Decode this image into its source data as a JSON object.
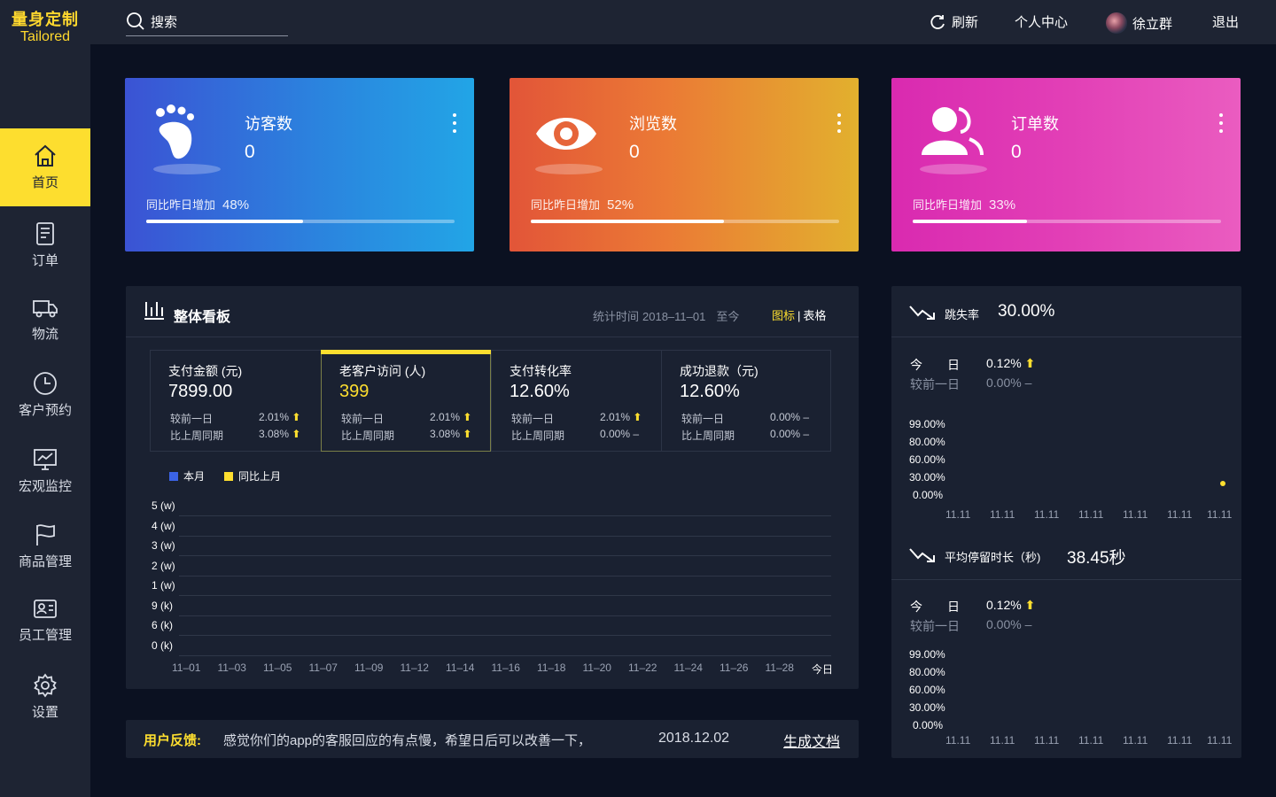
{
  "logo": {
    "cn": "量身定制",
    "en": "Tailored"
  },
  "sidebar": {
    "items": [
      {
        "label": "首页",
        "icon": "home-icon"
      },
      {
        "label": "订单",
        "icon": "order-icon"
      },
      {
        "label": "物流",
        "icon": "truck-icon"
      },
      {
        "label": "客户预约",
        "icon": "clock-icon"
      },
      {
        "label": "宏观监控",
        "icon": "monitor-icon"
      },
      {
        "label": "商品管理",
        "icon": "flag-icon"
      },
      {
        "label": "员工管理",
        "icon": "id-card-icon"
      },
      {
        "label": "设置",
        "icon": "gear-icon"
      }
    ],
    "active_index": 0
  },
  "topbar": {
    "search_label": "搜索",
    "refresh": "刷新",
    "profile": "个人中心",
    "user": "徐立群",
    "logout": "退出"
  },
  "cards": [
    {
      "title": "访客数",
      "value": "0",
      "sub": "同比昨日增加",
      "pct": "48%",
      "progress": 0.51
    },
    {
      "title": "浏览数",
      "value": "0",
      "sub": "同比昨日增加",
      "pct": "52%",
      "progress": 0.625
    },
    {
      "title": "订单数",
      "value": "0",
      "sub": "同比昨日增加",
      "pct": "33%",
      "progress": 0.37
    }
  ],
  "board": {
    "title": "整体看板",
    "time_label": "统计时间",
    "time_value": "2018–11–01",
    "time_suffix": "至今",
    "switch_chart": "图标",
    "switch_sep": "|",
    "switch_table": "表格",
    "kpis": [
      {
        "title": "支付金额 (元)",
        "value": "7899.00",
        "r1_label": "较前一日",
        "r1_value": "2.01%",
        "r1_arrow": "⬆",
        "r2_label": "比上周同期",
        "r2_value": "3.08%",
        "r2_arrow": "⬆"
      },
      {
        "title": "老客户访问 (人)",
        "value": "399",
        "r1_label": "较前一日",
        "r1_value": "2.01%",
        "r1_arrow": "⬆",
        "r2_label": "比上周同期",
        "r2_value": "3.08%",
        "r2_arrow": "⬆"
      },
      {
        "title": "支付转化率",
        "value": "12.60%",
        "r1_label": "较前一日",
        "r1_value": "2.01%",
        "r1_arrow": "⬆",
        "r2_label": "比上周同期",
        "r2_value": "0.00% –",
        "r2_arrow": ""
      },
      {
        "title": "成功退款（元)",
        "value": "12.60%",
        "r1_label": "较前一日",
        "r1_value": "0.00% –",
        "r1_arrow": "",
        "r2_label": "比上周同期",
        "r2_value": "0.00% –",
        "r2_arrow": ""
      }
    ],
    "selected_kpi": 1
  },
  "chart_data": [
    {
      "type": "line",
      "legend": [
        {
          "name": "本月",
          "color": "#3b63e6"
        },
        {
          "name": "同比上月",
          "color": "#fdde2f"
        }
      ],
      "y_ticks": [
        "5 (w)",
        "4 (w)",
        "3 (w)",
        "2 (w)",
        "1 (w)",
        "9 (k)",
        "6 (k)",
        "0 (k)"
      ],
      "x_ticks": [
        "11–01",
        "11–03",
        "11–05",
        "11–07",
        "11–09",
        "11–12",
        "11–14",
        "11–16",
        "11–18",
        "11–20",
        "11–22",
        "11–24",
        "11–26",
        "11–28",
        "今日"
      ],
      "series": [],
      "grid": true,
      "legend_position": "top-left"
    },
    {
      "type": "scatter",
      "y_ticks": [
        "99.00%",
        "80.00%",
        "60.00%",
        "30.00%",
        "0.00%"
      ],
      "x_ticks": [
        "11.11",
        "11.11",
        "11.11",
        "11.11",
        "11.11",
        "11.11",
        "11.11"
      ],
      "point_color": "#fdde2f",
      "grid": false
    },
    {
      "type": "line",
      "y_ticks": [
        "99.00%",
        "80.00%",
        "60.00%",
        "30.00%",
        "0.00%"
      ],
      "x_ticks": [
        "11.11",
        "11.11",
        "11.11",
        "11.11",
        "11.11",
        "11.11",
        "11.11"
      ],
      "grid": false
    }
  ],
  "feedback": {
    "label": "用户反馈:",
    "content": "感觉你们的app的客服回应的有点慢，希望日后可以改善一下，",
    "date": "2018.12.02",
    "button": "生成文档"
  },
  "right": {
    "bounce": {
      "title": "跳失率",
      "value": "30.00%",
      "today_label": "今　　日",
      "today_value": "0.12%",
      "today_arrow": "⬆",
      "prev_label": "较前一日",
      "prev_value": "0.00%  –"
    },
    "stay": {
      "title": "平均停留时长（秒)",
      "value": "38.45秒",
      "today_label": "今　　日",
      "today_value": "0.12%",
      "today_arrow": "⬆",
      "prev_label": "较前一日",
      "prev_value": "0.00%  –"
    }
  },
  "colors": {
    "accent": "#fdde2f",
    "sidebar": "#1e2433",
    "bg": "#0b1121",
    "panel": "#1a2131"
  }
}
